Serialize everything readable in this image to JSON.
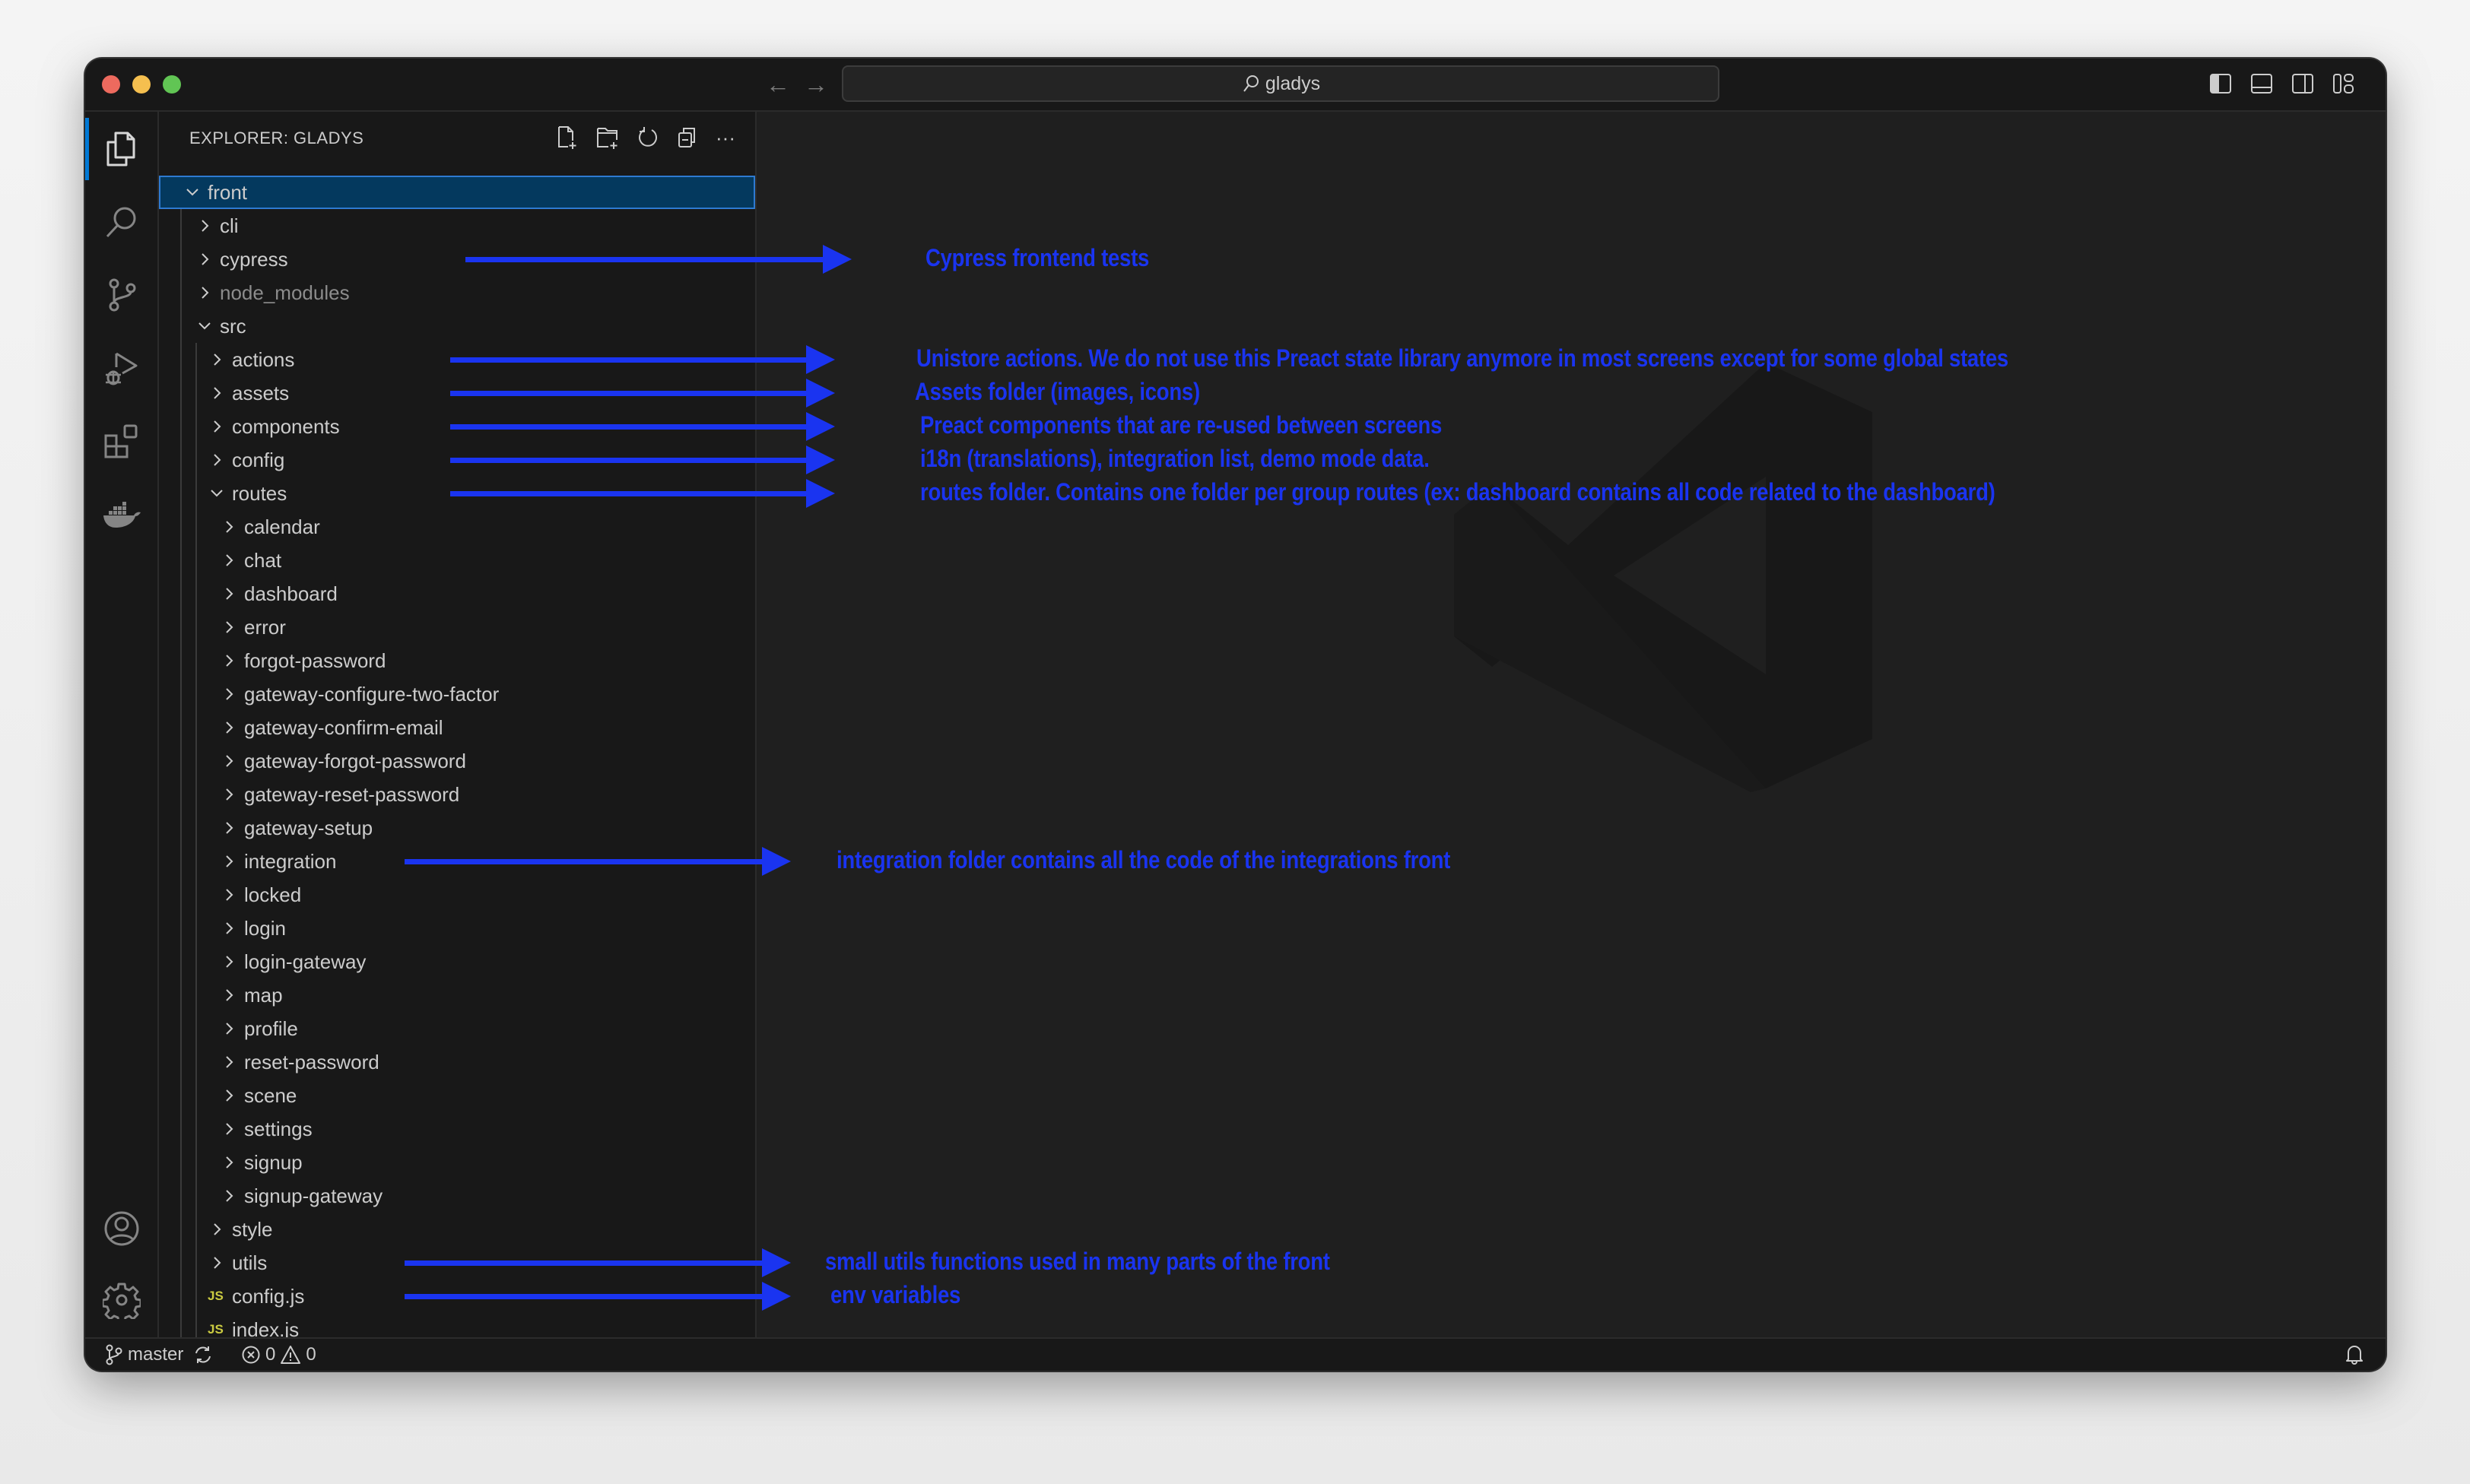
{
  "window": {
    "search_text": "gladys",
    "nav": {
      "back_icon": "arrow-left-icon",
      "forward_icon": "arrow-right-icon"
    },
    "layout_icons": [
      "toggle-primary-sidebar-icon",
      "toggle-panel-icon",
      "toggle-secondary-sidebar-icon",
      "customize-layout-icon"
    ]
  },
  "activity_bar": {
    "top": [
      {
        "name": "explorer",
        "icon": "files-icon",
        "active": true
      },
      {
        "name": "search",
        "icon": "search-icon"
      },
      {
        "name": "source-control",
        "icon": "source-control-icon"
      },
      {
        "name": "run-and-debug",
        "icon": "run-debug-icon"
      },
      {
        "name": "extensions",
        "icon": "extensions-icon"
      },
      {
        "name": "docker",
        "icon": "docker-icon"
      }
    ],
    "bottom": [
      {
        "name": "accounts",
        "icon": "account-icon"
      },
      {
        "name": "manage",
        "icon": "gear-icon"
      }
    ]
  },
  "sidebar": {
    "title": "EXPLORER: GLADYS",
    "actions": [
      "new-file-icon",
      "new-folder-icon",
      "refresh-icon",
      "collapse-all-icon",
      "more-icon"
    ],
    "more_label": "···",
    "tree": [
      {
        "label": "front",
        "depth": 0,
        "type": "folder",
        "expanded": true,
        "selected": true
      },
      {
        "label": "cli",
        "depth": 1,
        "type": "folder",
        "expanded": false
      },
      {
        "label": "cypress",
        "depth": 1,
        "type": "folder",
        "expanded": false
      },
      {
        "label": "node_modules",
        "depth": 1,
        "type": "folder",
        "expanded": false,
        "dim": true
      },
      {
        "label": "src",
        "depth": 1,
        "type": "folder",
        "expanded": true
      },
      {
        "label": "actions",
        "depth": 2,
        "type": "folder",
        "expanded": false
      },
      {
        "label": "assets",
        "depth": 2,
        "type": "folder",
        "expanded": false
      },
      {
        "label": "components",
        "depth": 2,
        "type": "folder",
        "expanded": false
      },
      {
        "label": "config",
        "depth": 2,
        "type": "folder",
        "expanded": false
      },
      {
        "label": "routes",
        "depth": 2,
        "type": "folder",
        "expanded": true
      },
      {
        "label": "calendar",
        "depth": 3,
        "type": "folder",
        "expanded": false
      },
      {
        "label": "chat",
        "depth": 3,
        "type": "folder",
        "expanded": false
      },
      {
        "label": "dashboard",
        "depth": 3,
        "type": "folder",
        "expanded": false
      },
      {
        "label": "error",
        "depth": 3,
        "type": "folder",
        "expanded": false
      },
      {
        "label": "forgot-password",
        "depth": 3,
        "type": "folder",
        "expanded": false
      },
      {
        "label": "gateway-configure-two-factor",
        "depth": 3,
        "type": "folder",
        "expanded": false
      },
      {
        "label": "gateway-confirm-email",
        "depth": 3,
        "type": "folder",
        "expanded": false
      },
      {
        "label": "gateway-forgot-password",
        "depth": 3,
        "type": "folder",
        "expanded": false
      },
      {
        "label": "gateway-reset-password",
        "depth": 3,
        "type": "folder",
        "expanded": false
      },
      {
        "label": "gateway-setup",
        "depth": 3,
        "type": "folder",
        "expanded": false
      },
      {
        "label": "integration",
        "depth": 3,
        "type": "folder",
        "expanded": false
      },
      {
        "label": "locked",
        "depth": 3,
        "type": "folder",
        "expanded": false
      },
      {
        "label": "login",
        "depth": 3,
        "type": "folder",
        "expanded": false
      },
      {
        "label": "login-gateway",
        "depth": 3,
        "type": "folder",
        "expanded": false
      },
      {
        "label": "map",
        "depth": 3,
        "type": "folder",
        "expanded": false
      },
      {
        "label": "profile",
        "depth": 3,
        "type": "folder",
        "expanded": false
      },
      {
        "label": "reset-password",
        "depth": 3,
        "type": "folder",
        "expanded": false
      },
      {
        "label": "scene",
        "depth": 3,
        "type": "folder",
        "expanded": false
      },
      {
        "label": "settings",
        "depth": 3,
        "type": "folder",
        "expanded": false
      },
      {
        "label": "signup",
        "depth": 3,
        "type": "folder",
        "expanded": false
      },
      {
        "label": "signup-gateway",
        "depth": 3,
        "type": "folder",
        "expanded": false
      },
      {
        "label": "style",
        "depth": 2,
        "type": "folder",
        "expanded": false
      },
      {
        "label": "utils",
        "depth": 2,
        "type": "folder",
        "expanded": false
      },
      {
        "label": "config.js",
        "depth": 2,
        "type": "js"
      },
      {
        "label": "index.js",
        "depth": 2,
        "type": "js"
      }
    ],
    "js_badge": "JS"
  },
  "annotations": [
    {
      "row": 2,
      "text": "Cypress frontend tests"
    },
    {
      "row": 5,
      "text": "Unistore actions. We do not use this Preact state library anymore in most screens except for some global states"
    },
    {
      "row": 6,
      "text": "Assets folder (images, icons)"
    },
    {
      "row": 7,
      "text": "Preact components that are re-used between screens"
    },
    {
      "row": 8,
      "text": "i18n (translations), integration list, demo mode data."
    },
    {
      "row": 9,
      "text": "routes folder. Contains one folder per group routes (ex: dashboard contains all code related to the dashboard)"
    },
    {
      "row": 20,
      "text": "integration folder contains all the code of the integrations front"
    },
    {
      "row": 32,
      "text": "small utils functions used in many parts of the front"
    },
    {
      "row": 33,
      "text": "env variables"
    }
  ],
  "annotation_color": "#1a34f0",
  "status_bar": {
    "branch": "master",
    "errors": "0",
    "warnings": "0",
    "notifications_icon": "bell-icon"
  }
}
